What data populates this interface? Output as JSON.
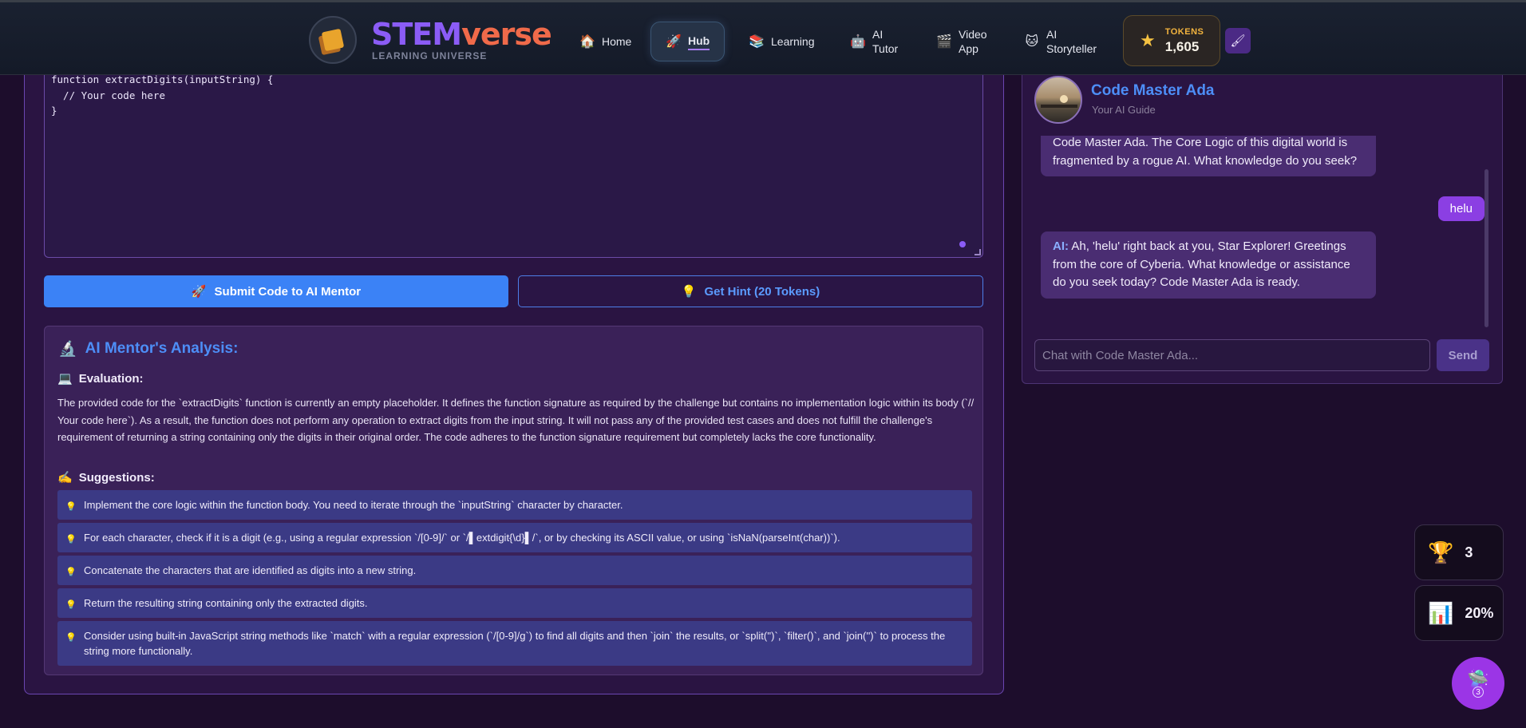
{
  "brand": {
    "name_part1": "STEM",
    "name_part2": "verse",
    "subtitle": "LEARNING UNIVERSE"
  },
  "nav": {
    "items": [
      {
        "label": "Home",
        "icon": "house-icon"
      },
      {
        "label": "Hub",
        "icon": "rocket-icon"
      },
      {
        "label": "Learning",
        "icon": "books-icon"
      },
      {
        "label": "AI\nTutor",
        "icon": "robot-icon"
      },
      {
        "label": "Video\nApp",
        "icon": "clapper-icon"
      },
      {
        "label": "AI\nStoryteller",
        "icon": "cat-face-icon"
      }
    ],
    "tokens_label": "TOKENS",
    "tokens_value": "1,605"
  },
  "editor": {
    "code": "function extractDigits(inputString) {\n  // Your code here\n}"
  },
  "actions": {
    "submit_label": "Submit Code to AI Mentor",
    "hint_label": "Get Hint (20 Tokens)"
  },
  "analysis": {
    "title": "AI Mentor's Analysis:",
    "evaluation_heading": "Evaluation:",
    "evaluation_text": "The provided code for the `extractDigits` function is currently an empty placeholder. It defines the function signature as required by the challenge but contains no implementation logic within its body (`// Your code here`). As a result, the function does not perform any operation to extract digits from the input string. It will not pass any of the provided test cases and does not fulfill the challenge's requirement of returning a string containing only the digits in their original order. The code adheres to the function signature requirement but completely lacks the core functionality.",
    "suggestions_heading": "Suggestions:",
    "suggestions": [
      "Implement the core logic within the function body. You need to iterate through the `inputString` character by character.",
      "For each character, check if it is a digit (e.g., using a regular expression `/[0-9]/` or `/▌extdigit{\\d}▌/`, or by checking its ASCII value, or using `isNaN(parseInt(char))`).",
      "Concatenate the characters that are identified as digits into a new string.",
      "Return the resulting string containing only the extracted digits.",
      "Consider using built-in JavaScript string methods like `match` with a regular expression (`/[0-9]/g`) to find all digits and then `join` the results, or `split('')`, `filter()`, and `join('')` to process the string more functionally."
    ]
  },
  "chat": {
    "name": "Code Master Ada",
    "subtitle": "Your AI Guide",
    "messages": [
      {
        "role": "ai",
        "text": "Code Master Ada. The Core Logic of this digital world is fragmented by a rogue AI. What knowledge do you seek?"
      },
      {
        "role": "user",
        "text": "helu"
      },
      {
        "role": "ai",
        "who": "AI:",
        "text": "Ah, 'helu' right back at you, Star Explorer! Greetings from the core of Cyberia. What knowledge or assistance do you seek today? Code Master Ada is ready."
      }
    ],
    "input_placeholder": "Chat with Code Master Ada...",
    "send_label": "Send"
  },
  "widgets": {
    "trophies": "3",
    "progress": "20%",
    "fab_badge": "3"
  },
  "colors": {
    "accent_blue": "#3b82f6",
    "accent_purple": "#8b5cf6",
    "brand_orange": "#f06a4a",
    "tokens_gold": "#f3b43e"
  }
}
